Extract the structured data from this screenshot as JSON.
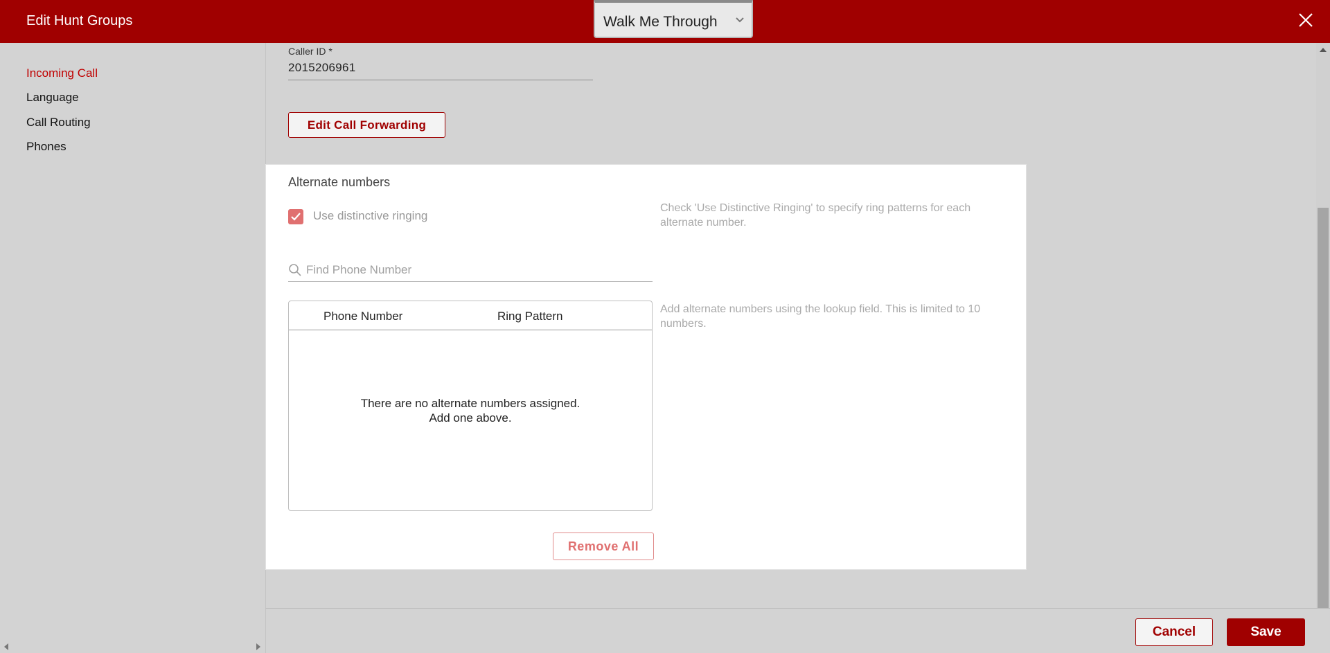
{
  "header": {
    "title": "Edit Hunt Groups",
    "walk_me_through": "Walk Me Through",
    "close_icon": "close-icon"
  },
  "sidebar": {
    "items": [
      {
        "label": "Incoming Call",
        "active": true
      },
      {
        "label": "Language",
        "active": false
      },
      {
        "label": "Call Routing",
        "active": false
      },
      {
        "label": "Phones",
        "active": false
      }
    ]
  },
  "main": {
    "caller_id_label": "Caller ID *",
    "caller_id_value": "2015206961",
    "edit_call_forwarding_label": "Edit Call Forwarding",
    "alternate": {
      "title": "Alternate numbers",
      "distinctive_ringing_label": "Use distinctive ringing",
      "distinctive_ringing_checked": true,
      "distinctive_hint": "Check 'Use Distinctive Ringing' to specify ring patterns for each alternate number.",
      "search_placeholder": "Find Phone Number",
      "table_headers": [
        "Phone Number",
        "Ring Pattern"
      ],
      "empty_line1": "There are no alternate numbers assigned.",
      "empty_line2": "Add one above.",
      "lookup_hint": "Add alternate numbers using the lookup field. This is limited to 10 numbers.",
      "remove_all_label": "Remove All"
    }
  },
  "footer": {
    "cancel_label": "Cancel",
    "save_label": "Save"
  },
  "colors": {
    "brand": "#a00000",
    "active_nav": "#c00000",
    "checkbox": "#e07070",
    "hint_text": "#a9a9a9"
  }
}
